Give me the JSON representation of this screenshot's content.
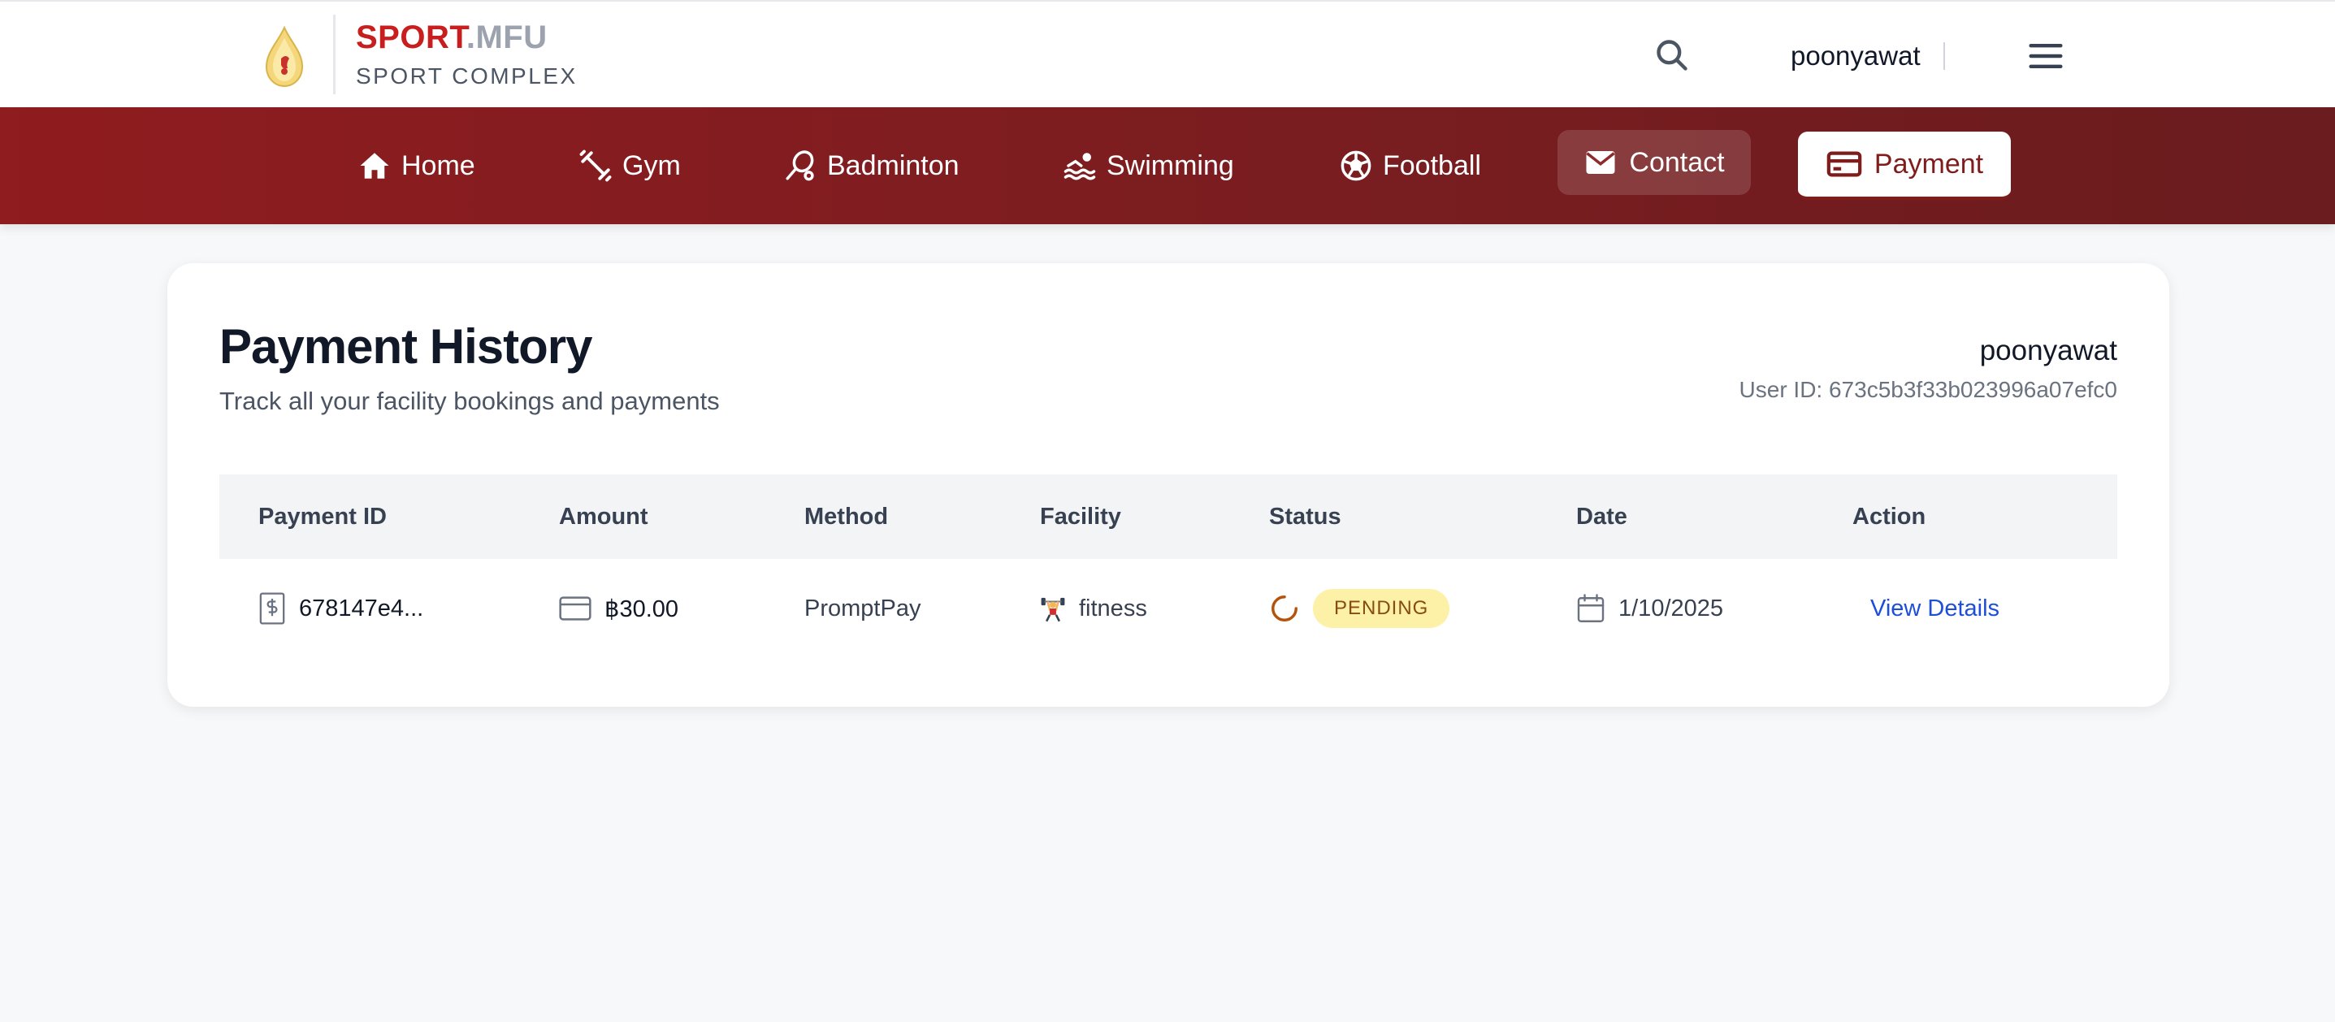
{
  "header": {
    "brand_primary": "SPORT",
    "brand_secondary": ".MFU",
    "brand_sub": "SPORT COMPLEX",
    "username": "poonyawat",
    "icons": {
      "search": "search-icon",
      "menu": "hamburger-menu-icon",
      "logo": "mfu-emblem-logo"
    }
  },
  "nav": {
    "items": [
      {
        "label": "Home",
        "icon": "home-icon"
      },
      {
        "label": "Gym",
        "icon": "dumbbell-icon"
      },
      {
        "label": "Badminton",
        "icon": "badminton-racket-icon"
      },
      {
        "label": "Swimming",
        "icon": "swimmer-icon"
      },
      {
        "label": "Football",
        "icon": "football-icon"
      },
      {
        "label": "Contact",
        "icon": "mail-icon"
      },
      {
        "label": "Payment",
        "icon": "credit-card-icon",
        "active": true
      }
    ]
  },
  "page": {
    "title": "Payment History",
    "subtitle": "Track all your facility bookings and payments",
    "username": "poonyawat",
    "user_id": "User ID: 673c5b3f33b023996a07efc0"
  },
  "table": {
    "headers": [
      "Payment ID",
      "Amount",
      "Method",
      "Facility",
      "Status",
      "Date",
      "Action"
    ],
    "rows": [
      {
        "payment_id": "678147e4...",
        "amount": "฿30.00",
        "method": "PromptPay",
        "facility": "fitness",
        "status": "PENDING",
        "date": "1/10/2025",
        "action": "View Details"
      }
    ]
  },
  "colors": {
    "brand_red": "#c81e1e",
    "nav_red": "#8f1c1f",
    "pending_badge_bg": "#fdf0a7",
    "pending_badge_text": "#854d0e",
    "link_blue": "#1d4ed8"
  }
}
